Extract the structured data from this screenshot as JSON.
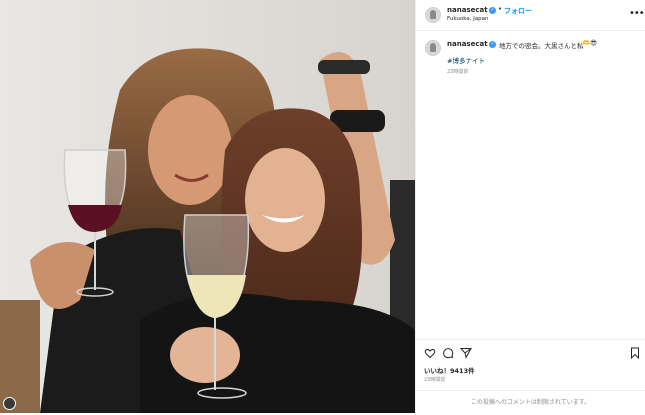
{
  "post": {
    "username": "nanasecat",
    "follow_label": "フォロー",
    "location": "Fukuoka, Japan",
    "caption_text": "地方での密会。大黒さんと私",
    "caption_emoji": "🫶😎",
    "hashtag": "#博多ナイト",
    "time_ago": "23時間前",
    "likes": "いいね！9413件",
    "likes_time": "23時間前",
    "comments_disabled": "この投稿へのコメントは制限されています。",
    "more_label": "•••"
  },
  "icons": [
    "heart-icon",
    "comment-icon",
    "share-icon",
    "bookmark-icon",
    "more-options-icon",
    "verified-icon"
  ],
  "colors": {
    "follow": "#0095f6",
    "verified": "#3897f0",
    "hashtag": "#00376b",
    "muted": "#8e8e8e"
  }
}
